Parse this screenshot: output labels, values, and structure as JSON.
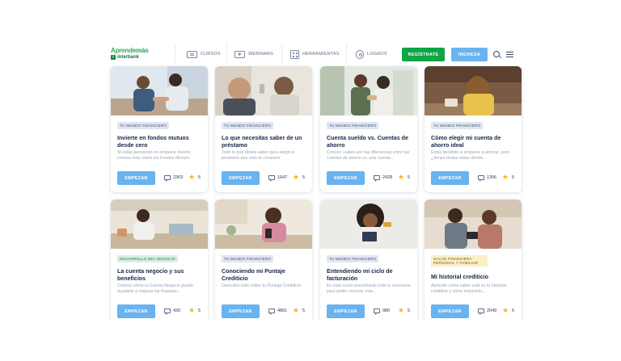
{
  "logo": {
    "top_a": "Aprende",
    "top_b": "más",
    "bottom": "interbank",
    "bottom_mark": "i"
  },
  "nav": [
    {
      "label": "CURSOS",
      "icon": "courses-icon"
    },
    {
      "label": "WEBINARS",
      "icon": "webinar-icon"
    },
    {
      "label": "HERRAMIENTAS",
      "icon": "tools-icon"
    },
    {
      "label": "LOGROS",
      "icon": "achievements-icon"
    }
  ],
  "actions": {
    "register": "REGÍSTRATE",
    "login": "INGRESA"
  },
  "colors": {
    "register": "#0fa444",
    "primary": "#69b3f0",
    "star": "#f4b820",
    "tag_bg": "#dfe6f1"
  },
  "cards": [
    {
      "tag": "TU MUNDO FINANCIERO",
      "title": "Invierte en fondos mutuos desde cero",
      "desc": "Si estás pensando en empezar invertir, conoce más sobre los Fondos Mutuos",
      "button": "EMPEZAR",
      "comments": "2363",
      "rating": "5"
    },
    {
      "tag": "TU MUNDO FINANCIERO",
      "title": "Lo que necesitas saber de un préstamo",
      "desc": "Todo lo que debes saber para elegir el préstamo que más te conviene",
      "button": "EMPEZAR",
      "comments": "1647",
      "rating": "5"
    },
    {
      "tag": "TU MUNDO FINANCIERO",
      "title": "Cuenta sueldo vs. Cuentas de ahorro",
      "desc": "Conoce cuáles son las diferencias entre las cuentas de ahorro vs. una cuenta...",
      "button": "EMPEZAR",
      "comments": "2428",
      "rating": "5"
    },
    {
      "tag": "TU MUNDO FINANCIERO",
      "title": "Cómo elegir mi cuenta de ahorro ideal",
      "desc": "Estás decidido a empezar a ahorrar, pero ¿tienes dudas sobre dónde...",
      "button": "EMPEZAR",
      "comments": "1356",
      "rating": "5"
    },
    {
      "tag": "DESARROLLO DEL NEGOCIO",
      "title": "La cuenta negocio y sus beneficios",
      "desc": "Conoce cómo la Cuenta Negocio puede ayudarte a mejorar las finanzas...",
      "button": "EMPEZAR",
      "comments": "430",
      "rating": "5"
    },
    {
      "tag": "TU MUNDO FINANCIERO",
      "title": "Conociendo mi Puntaje Crediticio",
      "desc": "Descubre todo sobre tu Puntaje Crediticio",
      "button": "EMPEZAR",
      "comments": "4861",
      "rating": "5"
    },
    {
      "tag": "TU MUNDO FINANCIERO",
      "title": "Entendiendo mi ciclo de facturación",
      "desc": "En este curso encontrarás todo lo necesario para poder conocer más...",
      "button": "EMPEZAR",
      "comments": "980",
      "rating": "5"
    },
    {
      "tag": "SALUD FINANCIERA PERSONAL Y FAMILIAR",
      "title": "Mi historial crediticio",
      "desc": "Aprende cómo saber cuál es tu historial crediticio y cómo mejorarlo...",
      "button": "EMPEZAR",
      "comments": "2049",
      "rating": "5"
    }
  ]
}
